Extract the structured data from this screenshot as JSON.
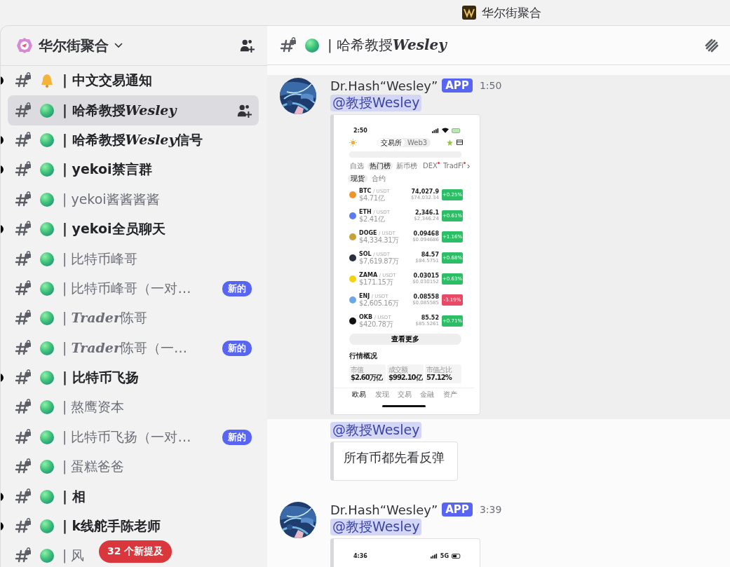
{
  "window": {
    "title": "华尔街聚合"
  },
  "sidebar": {
    "server_name": "华尔街聚合",
    "channels": [
      {
        "kind": "bell",
        "name": [
          {
            "text": "| 中文交易通知",
            "italic": false
          }
        ],
        "unread": true,
        "selected": false
      },
      {
        "kind": "ball",
        "name": [
          {
            "text": "| 哈希教授",
            "italic": false
          },
          {
            "text": "Wesley",
            "italic": true
          }
        ],
        "unread": false,
        "selected": true
      },
      {
        "kind": "ball",
        "name": [
          {
            "text": "| 哈希教授",
            "italic": false
          },
          {
            "text": "Wesley",
            "italic": true
          },
          {
            "text": "信号",
            "italic": false
          }
        ],
        "unread": true,
        "selected": false
      },
      {
        "kind": "ball",
        "name": [
          {
            "text": "| yekoi禁言群",
            "italic": false
          }
        ],
        "unread": true,
        "selected": false
      },
      {
        "kind": "ball",
        "name": [
          {
            "text": "| yekoi酱酱酱酱",
            "italic": false
          }
        ],
        "unread": false,
        "selected": false
      },
      {
        "kind": "ball",
        "name": [
          {
            "text": "| yekoi全员聊天",
            "italic": false
          }
        ],
        "unread": true,
        "selected": false
      },
      {
        "kind": "ball",
        "name": [
          {
            "text": "| 比特币峰哥",
            "italic": false
          }
        ],
        "unread": false,
        "selected": false
      },
      {
        "kind": "ball",
        "name": [
          {
            "text": "| 比特币峰哥（一对…",
            "italic": false
          }
        ],
        "unread": false,
        "selected": false,
        "badge": "新的"
      },
      {
        "kind": "ball",
        "name": [
          {
            "text": "| ",
            "italic": false
          },
          {
            "text": "Trader",
            "italic": true
          },
          {
            "text": "陈哥",
            "italic": false
          }
        ],
        "unread": false,
        "selected": false
      },
      {
        "kind": "ball",
        "name": [
          {
            "text": "| ",
            "italic": false
          },
          {
            "text": "Trader",
            "italic": true
          },
          {
            "text": "陈哥（一…",
            "italic": false
          }
        ],
        "unread": false,
        "selected": false,
        "badge": "新的"
      },
      {
        "kind": "ball",
        "name": [
          {
            "text": "| 比特币飞扬",
            "italic": false
          }
        ],
        "unread": true,
        "selected": false
      },
      {
        "kind": "ball",
        "name": [
          {
            "text": "| 熬鹰资本",
            "italic": false
          }
        ],
        "unread": false,
        "selected": false
      },
      {
        "kind": "ball",
        "name": [
          {
            "text": "| 比特币飞扬（一对…",
            "italic": false
          }
        ],
        "unread": false,
        "selected": false,
        "badge": "新的"
      },
      {
        "kind": "ball",
        "name": [
          {
            "text": "| 蛋糕爸爸",
            "italic": false
          }
        ],
        "unread": false,
        "selected": false
      },
      {
        "kind": "ball",
        "name": [
          {
            "text": "| 相",
            "italic": false
          }
        ],
        "unread": true,
        "selected": false
      },
      {
        "kind": "ball",
        "name": [
          {
            "text": "| k线舵手陈老师",
            "italic": false
          }
        ],
        "unread": true,
        "selected": false
      },
      {
        "kind": "ball",
        "name": [
          {
            "text": "| 风",
            "italic": false
          }
        ],
        "unread": false,
        "selected": false
      }
    ],
    "mentions_pill": "32 个新提及"
  },
  "channel_header": {
    "name": [
      {
        "text": "| 哈希教授",
        "italic": false
      },
      {
        "text": "Wesley",
        "italic": true
      }
    ]
  },
  "messages": [
    {
      "author": "Dr.Hash“Wesley”",
      "tag": "APP",
      "time": "1:50",
      "highlighted": true,
      "mention": "@教授Wesley",
      "embed": {
        "kind": "phone",
        "time": "2:50",
        "top_tabs": [
          {
            "label": "交易所",
            "selected": true
          },
          {
            "label": "Web3",
            "selected": false
          }
        ],
        "tabs": [
          {
            "label": "自选",
            "selected": false,
            "dot": false
          },
          {
            "label": "热门榜",
            "selected": true,
            "dot": false
          },
          {
            "label": "新币榜",
            "selected": false,
            "dot": false
          },
          {
            "label": "DEX",
            "selected": false,
            "dot": true
          },
          {
            "label": "TradFi",
            "selected": false,
            "dot": true
          }
        ],
        "subtabs": [
          {
            "label": "现货",
            "selected": true
          },
          {
            "label": "合约",
            "selected": false
          }
        ],
        "coins": [
          {
            "symbol": "BTC",
            "quote": "/ USDT",
            "volume": "$4.71亿",
            "price": "74,027.9",
            "usd": "$74,032.34",
            "change": "+0.25%",
            "up": true,
            "color": "#f0952a"
          },
          {
            "symbol": "ETH",
            "quote": "/ USDT",
            "volume": "$2.41亿",
            "price": "2,346.1",
            "usd": "$2,346.24",
            "change": "+0.61%",
            "up": true,
            "color": "#5b7cf0"
          },
          {
            "symbol": "DOGE",
            "quote": "/ USDT",
            "volume": "$4,334.31万",
            "price": "0.09468",
            "usd": "$0.094686",
            "change": "+1.16%",
            "up": true,
            "color": "#c7a13a"
          },
          {
            "symbol": "SOL",
            "quote": "/ USDT",
            "volume": "$7,619.87万",
            "price": "84.57",
            "usd": "$84.5751",
            "change": "+0.68%",
            "up": true,
            "color": "#2a2f3d"
          },
          {
            "symbol": "ZAMA",
            "quote": "/ USDT",
            "volume": "$171.15万",
            "price": "0.03015",
            "usd": "$0.030152",
            "change": "+0.63%",
            "up": true,
            "color": "#f5d20f"
          },
          {
            "symbol": "ENJ",
            "quote": "/ USDT",
            "volume": "$2,605.16万",
            "price": "0.08558",
            "usd": "$0.085585",
            "change": "-3.19%",
            "up": false,
            "color": "#6aa8e8"
          },
          {
            "symbol": "OKB",
            "quote": "/ USDT",
            "volume": "$420.78万",
            "price": "85.52",
            "usd": "$85.5261",
            "change": "+0.71%",
            "up": true,
            "color": "#111111"
          }
        ],
        "more": "查看更多",
        "overview": "行情概况",
        "stats": [
          {
            "label": "市值",
            "value": "$2.60万亿"
          },
          {
            "label": "成交额",
            "value": "$992.10亿"
          },
          {
            "label": "市值占比",
            "value": "57.12%"
          }
        ],
        "nav": [
          {
            "label": "欧易",
            "selected": true
          },
          {
            "label": "发现",
            "selected": false
          },
          {
            "label": "交易",
            "selected": false
          },
          {
            "label": "金融",
            "selected": false
          },
          {
            "label": "资产",
            "selected": false
          }
        ]
      }
    },
    {
      "mention": "@教授Wesley",
      "highlighted": false,
      "embed": {
        "kind": "text",
        "text": "所有币都先看反弹"
      }
    },
    {
      "author": "Dr.Hash“Wesley”",
      "tag": "APP",
      "time": "3:39",
      "highlighted": false,
      "mention": "@教授Wesley",
      "embed": {
        "kind": "phone_top",
        "time": "4:36",
        "network": "5G"
      }
    }
  ]
}
